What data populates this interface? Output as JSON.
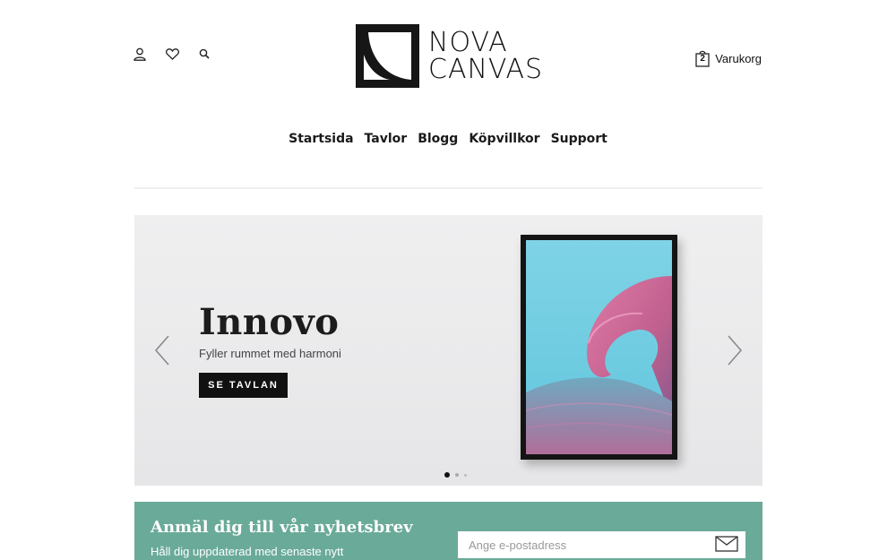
{
  "header": {
    "icons": [
      "user-icon",
      "heart-icon",
      "search-icon"
    ],
    "logo": {
      "line1": "NOVA",
      "line2": "CANVAS"
    },
    "cart": {
      "label": "Varukorg",
      "count": "2",
      "icon": "shopping-bag-icon"
    }
  },
  "nav": {
    "items": [
      {
        "label": "Startsida"
      },
      {
        "label": "Tavlor"
      },
      {
        "label": "Blogg"
      },
      {
        "label": "Köpvillkor"
      },
      {
        "label": "Support"
      }
    ]
  },
  "hero": {
    "title": "Innovo",
    "subtitle": "Fyller rummet med harmoni",
    "button_label": "SE TAVLAN",
    "slides_total": 3,
    "active_slide": 1
  },
  "newsletter": {
    "title": "Anmäl dig till vår nyhetsbrev",
    "subtitle": "Håll dig uppdaterad med senaste nytt",
    "input_placeholder": "Ange e-postadress",
    "send_icon": "envelope-icon"
  },
  "colors": {
    "newsletter_bg": "#6aaa98",
    "hero_bg": "#ececed",
    "button_bg": "#111111"
  }
}
